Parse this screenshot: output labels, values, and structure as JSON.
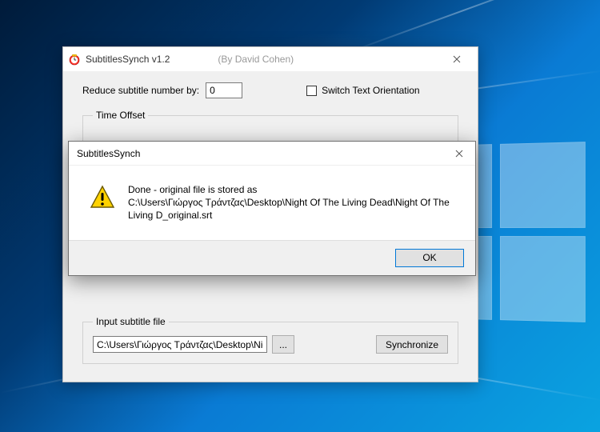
{
  "main_window": {
    "title": "SubtitlesSynch v1.2",
    "byline": "(By David Cohen)",
    "reduce_label": "Reduce subtitle number by:",
    "reduce_value": "0",
    "switch_orientation_label": "Switch Text Orientation",
    "switch_orientation_checked": false,
    "time_offset_legend": "Time Offset",
    "input_file_legend": "Input subtitle file",
    "input_file_value": "C:\\Users\\Γιώργος Τράντζας\\Desktop\\Night Of",
    "browse_label": "...",
    "sync_label": "Synchronize"
  },
  "dialog": {
    "title": "SubtitlesSynch",
    "message_line1": "Done - original file is stored as",
    "message_line2": "C:\\Users\\Γιώργος Τράντζας\\Desktop\\Night Of The Living Dead\\Night Of The Living D_original.srt",
    "ok_label": "OK"
  }
}
